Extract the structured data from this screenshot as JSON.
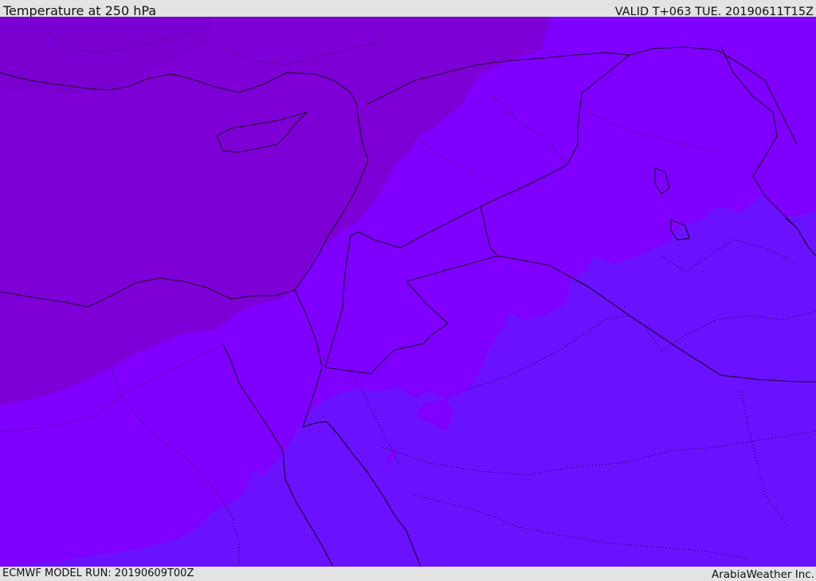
{
  "header": {
    "title": "Temperature at 250 hPa",
    "valid_time": "VALID T+063 TUE. 20190611T15Z"
  },
  "footer": {
    "model_run": "ECMWF MODEL RUN: 20190609T00Z",
    "credit": "ArabiaWeather Inc."
  },
  "map": {
    "colors": {
      "coldest": "#7e00d6",
      "mid": "#8000ff",
      "warmer": "#6a12ff",
      "border": "#1a0030"
    }
  }
}
